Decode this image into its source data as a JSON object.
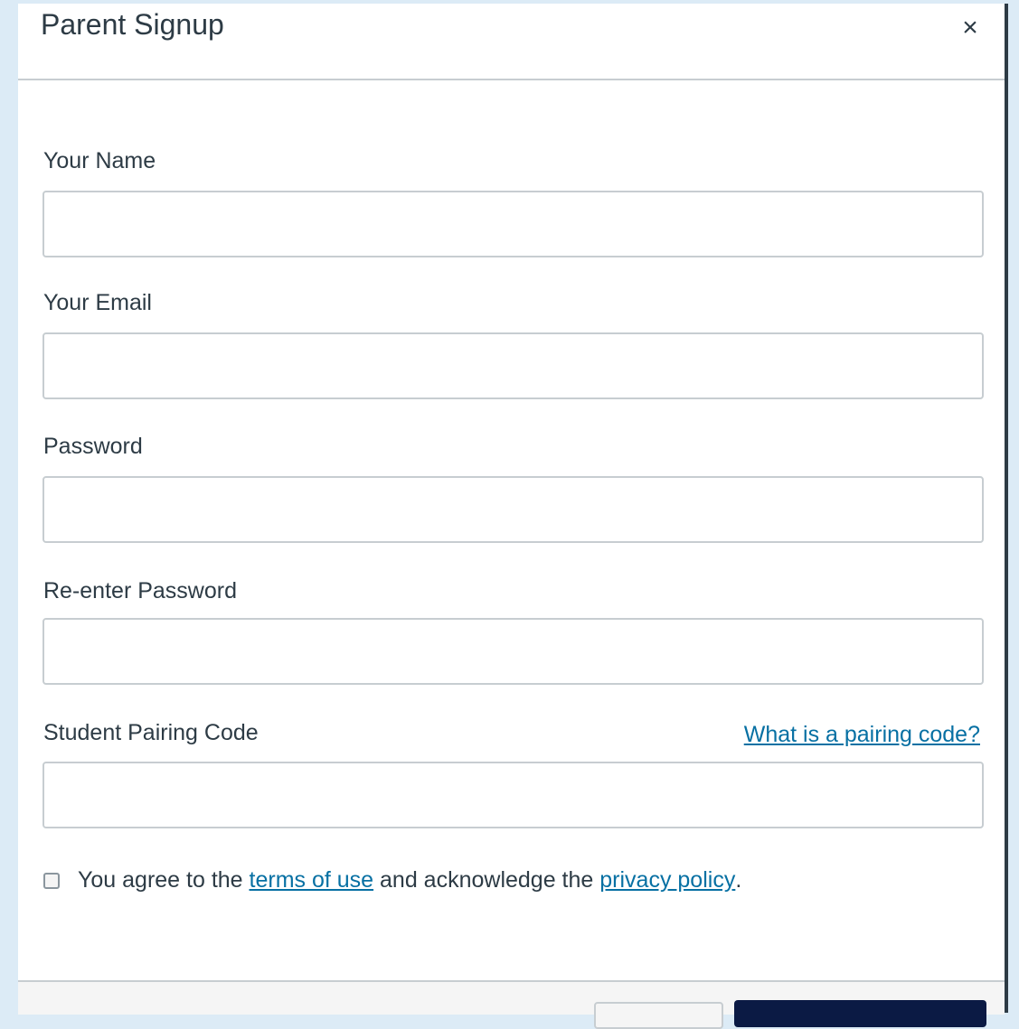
{
  "modal": {
    "title": "Parent Signup",
    "close_label": "×"
  },
  "form": {
    "fields": [
      {
        "label": "Your Name",
        "value": ""
      },
      {
        "label": "Your Email",
        "value": ""
      },
      {
        "label": "Password",
        "value": ""
      },
      {
        "label": "Re-enter Password",
        "value": ""
      },
      {
        "label": "Student Pairing Code",
        "value": ""
      }
    ],
    "pairing_help_link": "What is a pairing code?",
    "agreement": {
      "checked": false,
      "prefix": "You agree to the ",
      "terms_link": "terms of use",
      "middle": " and acknowledge the ",
      "privacy_link": "privacy policy",
      "suffix": "."
    }
  },
  "icons": {
    "close": "close-icon"
  },
  "colors": {
    "primary_button": "#0b1a44",
    "link": "#0770a3",
    "background": "#dcebf6"
  }
}
